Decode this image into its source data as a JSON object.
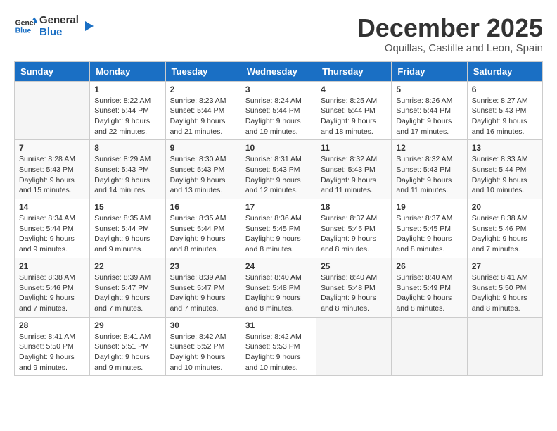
{
  "logo": {
    "line1": "General",
    "line2": "Blue"
  },
  "title": "December 2025",
  "subtitle": "Oquillas, Castille and Leon, Spain",
  "days_of_week": [
    "Sunday",
    "Monday",
    "Tuesday",
    "Wednesday",
    "Thursday",
    "Friday",
    "Saturday"
  ],
  "weeks": [
    [
      {
        "day": "",
        "info": ""
      },
      {
        "day": "1",
        "info": "Sunrise: 8:22 AM\nSunset: 5:44 PM\nDaylight: 9 hours\nand 22 minutes."
      },
      {
        "day": "2",
        "info": "Sunrise: 8:23 AM\nSunset: 5:44 PM\nDaylight: 9 hours\nand 21 minutes."
      },
      {
        "day": "3",
        "info": "Sunrise: 8:24 AM\nSunset: 5:44 PM\nDaylight: 9 hours\nand 19 minutes."
      },
      {
        "day": "4",
        "info": "Sunrise: 8:25 AM\nSunset: 5:44 PM\nDaylight: 9 hours\nand 18 minutes."
      },
      {
        "day": "5",
        "info": "Sunrise: 8:26 AM\nSunset: 5:44 PM\nDaylight: 9 hours\nand 17 minutes."
      },
      {
        "day": "6",
        "info": "Sunrise: 8:27 AM\nSunset: 5:43 PM\nDaylight: 9 hours\nand 16 minutes."
      }
    ],
    [
      {
        "day": "7",
        "info": "Sunrise: 8:28 AM\nSunset: 5:43 PM\nDaylight: 9 hours\nand 15 minutes."
      },
      {
        "day": "8",
        "info": "Sunrise: 8:29 AM\nSunset: 5:43 PM\nDaylight: 9 hours\nand 14 minutes."
      },
      {
        "day": "9",
        "info": "Sunrise: 8:30 AM\nSunset: 5:43 PM\nDaylight: 9 hours\nand 13 minutes."
      },
      {
        "day": "10",
        "info": "Sunrise: 8:31 AM\nSunset: 5:43 PM\nDaylight: 9 hours\nand 12 minutes."
      },
      {
        "day": "11",
        "info": "Sunrise: 8:32 AM\nSunset: 5:43 PM\nDaylight: 9 hours\nand 11 minutes."
      },
      {
        "day": "12",
        "info": "Sunrise: 8:32 AM\nSunset: 5:43 PM\nDaylight: 9 hours\nand 11 minutes."
      },
      {
        "day": "13",
        "info": "Sunrise: 8:33 AM\nSunset: 5:44 PM\nDaylight: 9 hours\nand 10 minutes."
      }
    ],
    [
      {
        "day": "14",
        "info": "Sunrise: 8:34 AM\nSunset: 5:44 PM\nDaylight: 9 hours\nand 9 minutes."
      },
      {
        "day": "15",
        "info": "Sunrise: 8:35 AM\nSunset: 5:44 PM\nDaylight: 9 hours\nand 9 minutes."
      },
      {
        "day": "16",
        "info": "Sunrise: 8:35 AM\nSunset: 5:44 PM\nDaylight: 9 hours\nand 8 minutes."
      },
      {
        "day": "17",
        "info": "Sunrise: 8:36 AM\nSunset: 5:45 PM\nDaylight: 9 hours\nand 8 minutes."
      },
      {
        "day": "18",
        "info": "Sunrise: 8:37 AM\nSunset: 5:45 PM\nDaylight: 9 hours\nand 8 minutes."
      },
      {
        "day": "19",
        "info": "Sunrise: 8:37 AM\nSunset: 5:45 PM\nDaylight: 9 hours\nand 8 minutes."
      },
      {
        "day": "20",
        "info": "Sunrise: 8:38 AM\nSunset: 5:46 PM\nDaylight: 9 hours\nand 7 minutes."
      }
    ],
    [
      {
        "day": "21",
        "info": "Sunrise: 8:38 AM\nSunset: 5:46 PM\nDaylight: 9 hours\nand 7 minutes."
      },
      {
        "day": "22",
        "info": "Sunrise: 8:39 AM\nSunset: 5:47 PM\nDaylight: 9 hours\nand 7 minutes."
      },
      {
        "day": "23",
        "info": "Sunrise: 8:39 AM\nSunset: 5:47 PM\nDaylight: 9 hours\nand 7 minutes."
      },
      {
        "day": "24",
        "info": "Sunrise: 8:40 AM\nSunset: 5:48 PM\nDaylight: 9 hours\nand 8 minutes."
      },
      {
        "day": "25",
        "info": "Sunrise: 8:40 AM\nSunset: 5:48 PM\nDaylight: 9 hours\nand 8 minutes."
      },
      {
        "day": "26",
        "info": "Sunrise: 8:40 AM\nSunset: 5:49 PM\nDaylight: 9 hours\nand 8 minutes."
      },
      {
        "day": "27",
        "info": "Sunrise: 8:41 AM\nSunset: 5:50 PM\nDaylight: 9 hours\nand 8 minutes."
      }
    ],
    [
      {
        "day": "28",
        "info": "Sunrise: 8:41 AM\nSunset: 5:50 PM\nDaylight: 9 hours\nand 9 minutes."
      },
      {
        "day": "29",
        "info": "Sunrise: 8:41 AM\nSunset: 5:51 PM\nDaylight: 9 hours\nand 9 minutes."
      },
      {
        "day": "30",
        "info": "Sunrise: 8:42 AM\nSunset: 5:52 PM\nDaylight: 9 hours\nand 10 minutes."
      },
      {
        "day": "31",
        "info": "Sunrise: 8:42 AM\nSunset: 5:53 PM\nDaylight: 9 hours\nand 10 minutes."
      },
      {
        "day": "",
        "info": ""
      },
      {
        "day": "",
        "info": ""
      },
      {
        "day": "",
        "info": ""
      }
    ]
  ]
}
